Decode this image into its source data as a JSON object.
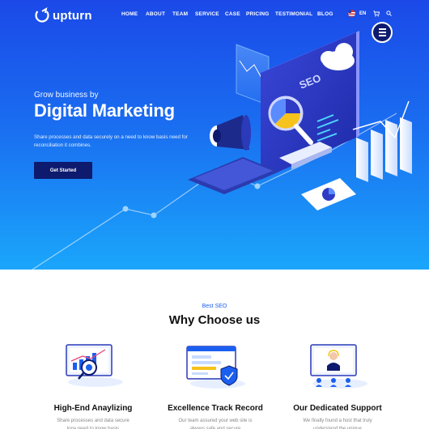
{
  "brand": {
    "name": "upturn"
  },
  "nav": {
    "items": [
      {
        "label": "HOME"
      },
      {
        "label": "ABOUT"
      },
      {
        "label": "TEAM"
      },
      {
        "label": "SERVICE"
      },
      {
        "label": "CASE"
      },
      {
        "label": "PRICING"
      },
      {
        "label": "TESTIMONIAL"
      },
      {
        "label": "BLOG"
      }
    ],
    "language": "EN",
    "icons": {
      "flag": "uk-flag-icon",
      "cart": "cart-icon",
      "search": "search-icon",
      "menu": "hamburger-menu-icon"
    }
  },
  "hero": {
    "tagline": "Grow business by",
    "headline": "Digital Marketing",
    "description": "Share processes and data securely on a need to know basis need for reconciliation it combines.",
    "cta_label": "Get Started",
    "illustration_label": "SEO"
  },
  "features_section": {
    "eyebrow": "Best SEO",
    "title": "Why Choose us",
    "items": [
      {
        "title": "High-End Anaylizing",
        "text": "Share processes and data secure lona need to know basis",
        "icon": "analytics-icon"
      },
      {
        "title": "Excellence Track Record",
        "text": "Our team assured your web site is always safe and secure",
        "icon": "secure-website-icon"
      },
      {
        "title": "Our Dedicated Support",
        "text": "We finally found a host that truly understand the unique",
        "icon": "support-agent-icon"
      }
    ]
  },
  "colors": {
    "hero_top": "#1b49e8",
    "hero_bottom": "#1aa6fb",
    "navy": "#0d1a6e",
    "accent": "#1b5ff0"
  }
}
